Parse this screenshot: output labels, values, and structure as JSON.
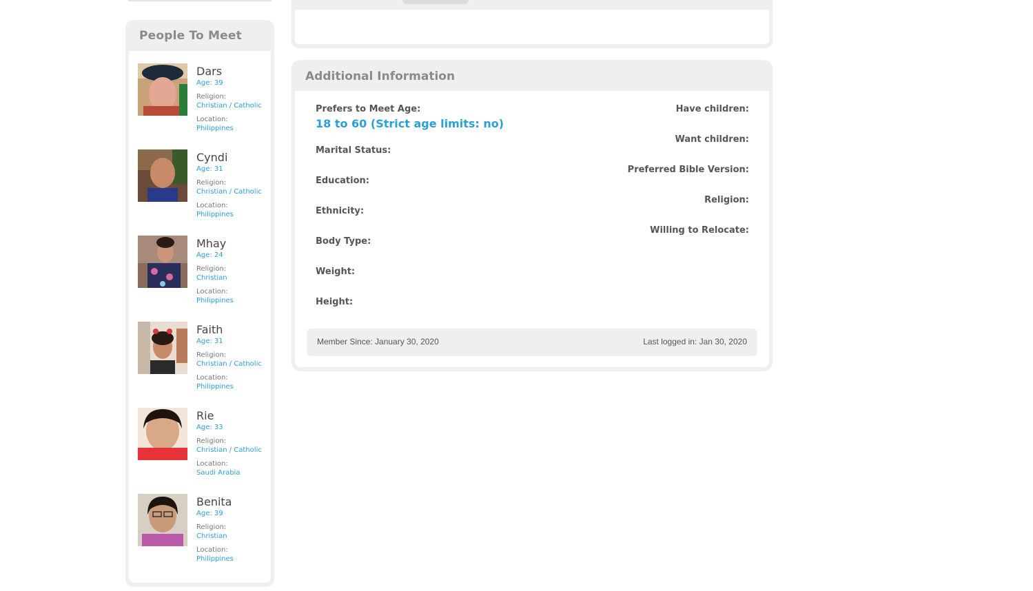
{
  "sidebar": {
    "title": "People To Meet",
    "people": [
      {
        "name": "Dars",
        "age": "Age: 39",
        "religion_label": "Religion:",
        "religion": "Christian / Catholic",
        "location_label": "Location:",
        "location": "Philippines"
      },
      {
        "name": "Cyndi",
        "age": "Age: 31",
        "religion_label": "Religion:",
        "religion": "Christian / Catholic",
        "location_label": "Location:",
        "location": "Philippines"
      },
      {
        "name": "Mhay",
        "age": "Age: 24",
        "religion_label": "Religion:",
        "religion": "Christian",
        "location_label": "Location:",
        "location": "Philippines"
      },
      {
        "name": "Faith",
        "age": "Age: 31",
        "religion_label": "Religion:",
        "religion": "Christian / Catholic",
        "location_label": "Location:",
        "location": "Philippines"
      },
      {
        "name": "Rie",
        "age": "Age: 33",
        "religion_label": "Religion:",
        "religion": "Christian / Catholic",
        "location_label": "Location:",
        "location": "Saudi Arabia"
      },
      {
        "name": "Benita",
        "age": "Age: 39",
        "religion_label": "Religion:",
        "religion": "Christian",
        "location_label": "Location:",
        "location": "Philippines"
      }
    ]
  },
  "info": {
    "title": "Additional Information",
    "prefers_age_label": "Prefers to Meet Age:",
    "prefers_age_value": "18 to 60 (Strict age limits: no)",
    "left_fields": [
      "Marital Status:",
      "Education:",
      "Ethnicity:",
      "Body Type:",
      "Weight:",
      "Height:"
    ],
    "right_fields": [
      "Have children:",
      "Want children:",
      "Preferred Bible Version:",
      "Religion:",
      "Willing to Relocate:"
    ],
    "member_since": "Member Since: January 30, 2020",
    "last_logged": "Last logged in: Jan 30, 2020"
  },
  "colors": {
    "accent": "#2b9fd8",
    "panel_bg": "#efefed",
    "heading": "#8a8a8a"
  }
}
